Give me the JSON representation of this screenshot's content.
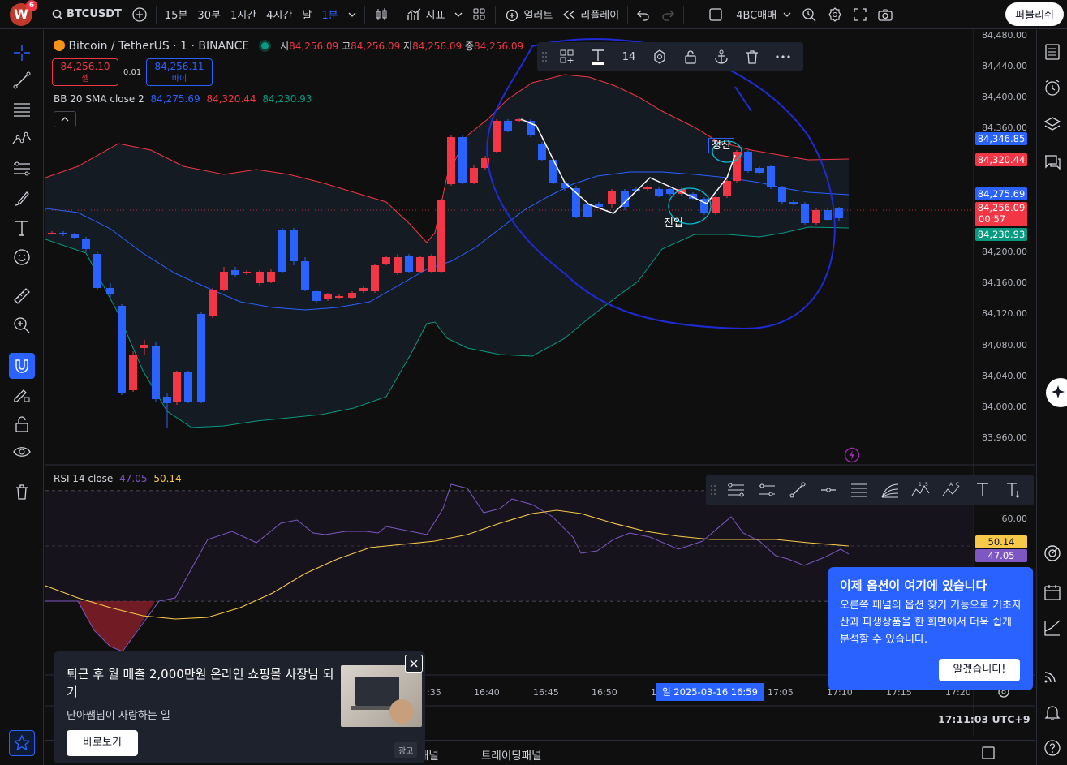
{
  "topbar": {
    "logo_letter": "W",
    "logo_badge": "6",
    "symbol": "BTCUSDT",
    "intervals": [
      "15분",
      "30분",
      "1시간",
      "4시간",
      "날",
      "1분"
    ],
    "indicators_label": "지표",
    "alert_label": "얼러트",
    "replay_label": "리플레이",
    "layout_name": "4BC매매",
    "publish_label": "퍼블리쉬"
  },
  "legend": {
    "title": "Bitcoin / TetherUS · 1 · BINANCE",
    "ohlc": [
      {
        "k": "시",
        "v": "84,256.09"
      },
      {
        "k": "고",
        "v": "84,256.09"
      },
      {
        "k": "저",
        "v": "84,256.09"
      },
      {
        "k": "종",
        "v": "84,256.09"
      }
    ],
    "sell_price": "84,256.10",
    "sell_label": "셀",
    "spread": "0.01",
    "buy_price": "84,256.11",
    "buy_label": "바이",
    "bb_name": "BB 20 SMA close 2",
    "bb_basis": "84,275.69",
    "bb_upper": "84,320.44",
    "bb_lower": "84,230.93",
    "rsi_name": "RSI 14 close",
    "rsi_value": "47.05",
    "rsi_ma": "50.14"
  },
  "drawing_toolbar": {
    "font_size": "14"
  },
  "annotations": {
    "entry": "진입",
    "exit": "청산"
  },
  "price_axis": [
    "84,480.00",
    "84,440.00",
    "84,400.00",
    "84,360.00",
    "84,200.00",
    "84,160.00",
    "84,120.00",
    "84,080.00",
    "84,040.00",
    "84,000.00",
    "83,960.00"
  ],
  "price_tags": [
    {
      "label": "84,346.85",
      "color": "#2962ff"
    },
    {
      "label": "84,320.44",
      "color": "#f23645"
    },
    {
      "label": "84,275.69",
      "color": "#2962ff"
    },
    {
      "label": "84,256.09",
      "sub": "00:57",
      "color": "#f23645"
    },
    {
      "label": "84,230.93",
      "color": "#089981"
    }
  ],
  "rsi_axis": [
    "60.00"
  ],
  "rsi_tags": [
    {
      "label": "50.14",
      "color": "#f7c948",
      "text": "#131722"
    },
    {
      "label": "47.05",
      "color": "#7e57c2",
      "text": "#ffffff"
    }
  ],
  "time_axis": [
    ":35",
    "16:40",
    "16:45",
    "16:50",
    "1",
    "17:05",
    "17:10",
    "17:15",
    "17:20"
  ],
  "crosshair_time": "일 2025-03-16  16:59",
  "clock": "17:11:03 UTC+9",
  "ad": {
    "title": "퇴근 후 월 매출 2,000만원 온라인 쇼핑몰 사장님 되기",
    "subtitle": "단아쌤님이 사랑하는 일",
    "button": "바로보기",
    "badge": "광고"
  },
  "popup": {
    "title": "이제 옵션이 여기에 있습니다",
    "body": "오른쪽 패널의 옵션 찾기 기능으로 기초자산과 파생상품을 한 화면에서 더욱 쉽게 분석할 수 있습니다.",
    "button": "알겠습니다!"
  },
  "bottom_tabs": [
    "패널",
    "트레이딩패널"
  ],
  "colors": {
    "up": "#f23645",
    "down": "#2962ff",
    "accent": "#2962ff",
    "bb_lower": "#089981",
    "rsi_line": "#7e57c2",
    "rsi_ma": "#f7c948"
  }
}
